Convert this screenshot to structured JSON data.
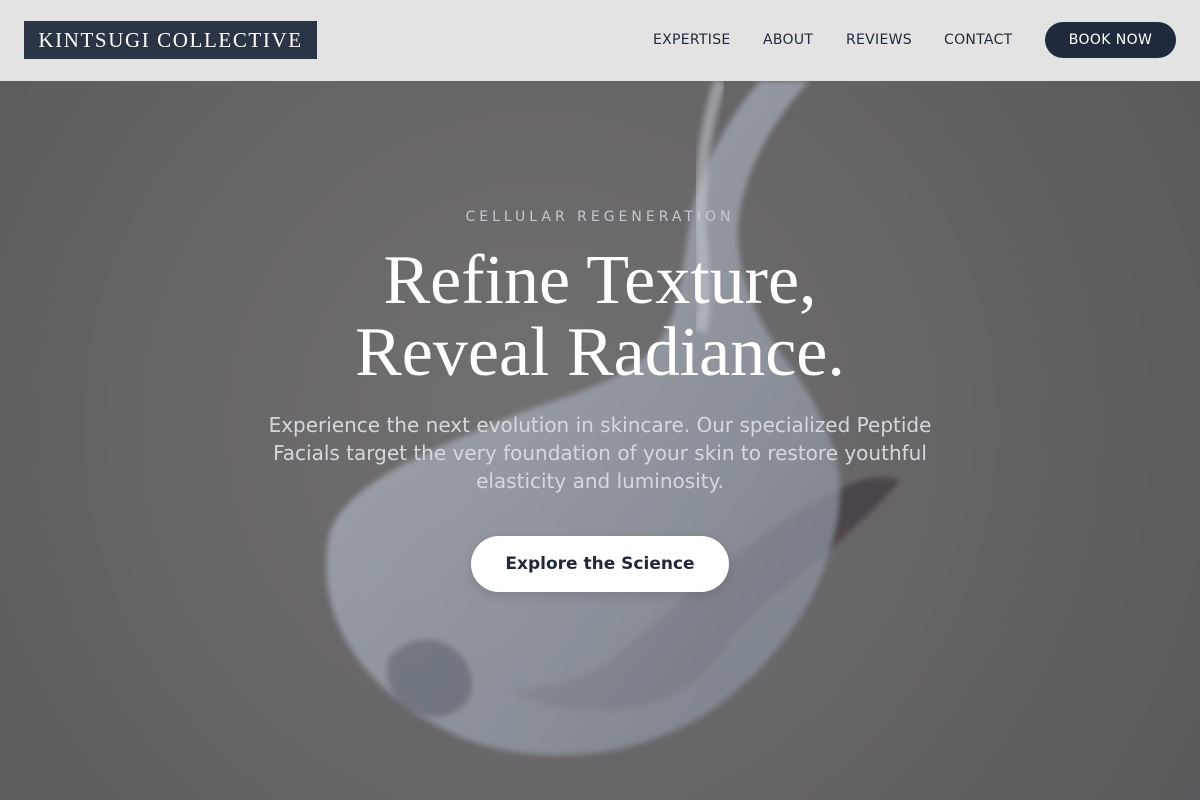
{
  "header": {
    "logo_text": "KINTSUGI COLLECTIVE",
    "nav": [
      "EXPERTISE",
      "ABOUT",
      "REVIEWS",
      "CONTACT"
    ],
    "book_button": "BOOK NOW"
  },
  "hero": {
    "eyebrow": "CELLULAR REGENERATION",
    "headline_line1": "Refine Texture,",
    "headline_line2": "Reveal Radiance.",
    "subtext": "Experience the next evolution in skincare. Our specialized Peptide Facials target the very foundation of your skin to restore youthful elasticity and luminosity.",
    "cta": "Explore the Science"
  },
  "colors": {
    "header_bg": "#e3e3e3",
    "logo_bg": "#2a3445",
    "accent_dark": "#1f2a3d",
    "hero_overlay": "#6f6e6f"
  }
}
